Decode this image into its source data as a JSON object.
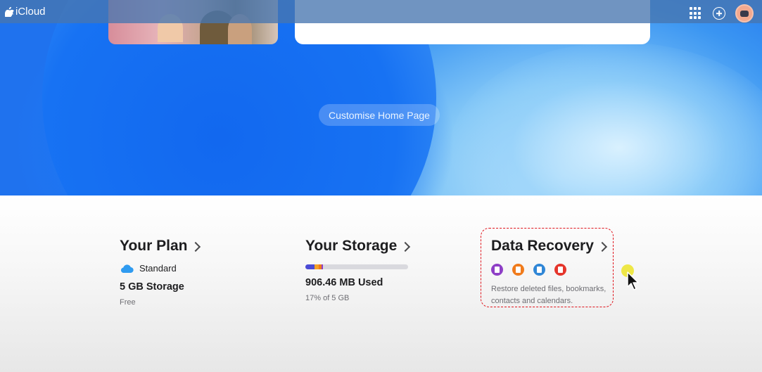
{
  "topbar": {
    "brand": "iCloud",
    "icons": [
      "apple-logo-icon",
      "app-grid-icon",
      "add-circle-icon",
      "avatar"
    ]
  },
  "hero": {
    "customise_label": "Customise Home Page",
    "colors": {
      "primary": "#1d6fee",
      "highlight": "#bfe4fb"
    }
  },
  "plan": {
    "title": "Your Plan",
    "tier": "Standard",
    "storage": "5 GB Storage",
    "price": "Free"
  },
  "storage": {
    "title": "Your Storage",
    "used": "906.46 MB Used",
    "percent_text": "17% of 5 GB",
    "used_fraction": 0.17
  },
  "recovery": {
    "title": "Data Recovery",
    "description": "Restore deleted files, bookmarks, contacts and calendars.",
    "icons": [
      {
        "name": "files-recovery-icon",
        "color": "#8e3fc6"
      },
      {
        "name": "bookmarks-recovery-icon",
        "color": "#f07b1c"
      },
      {
        "name": "contacts-recovery-icon",
        "color": "#2f86d6"
      },
      {
        "name": "calendars-recovery-icon",
        "color": "#e5352b"
      }
    ]
  }
}
